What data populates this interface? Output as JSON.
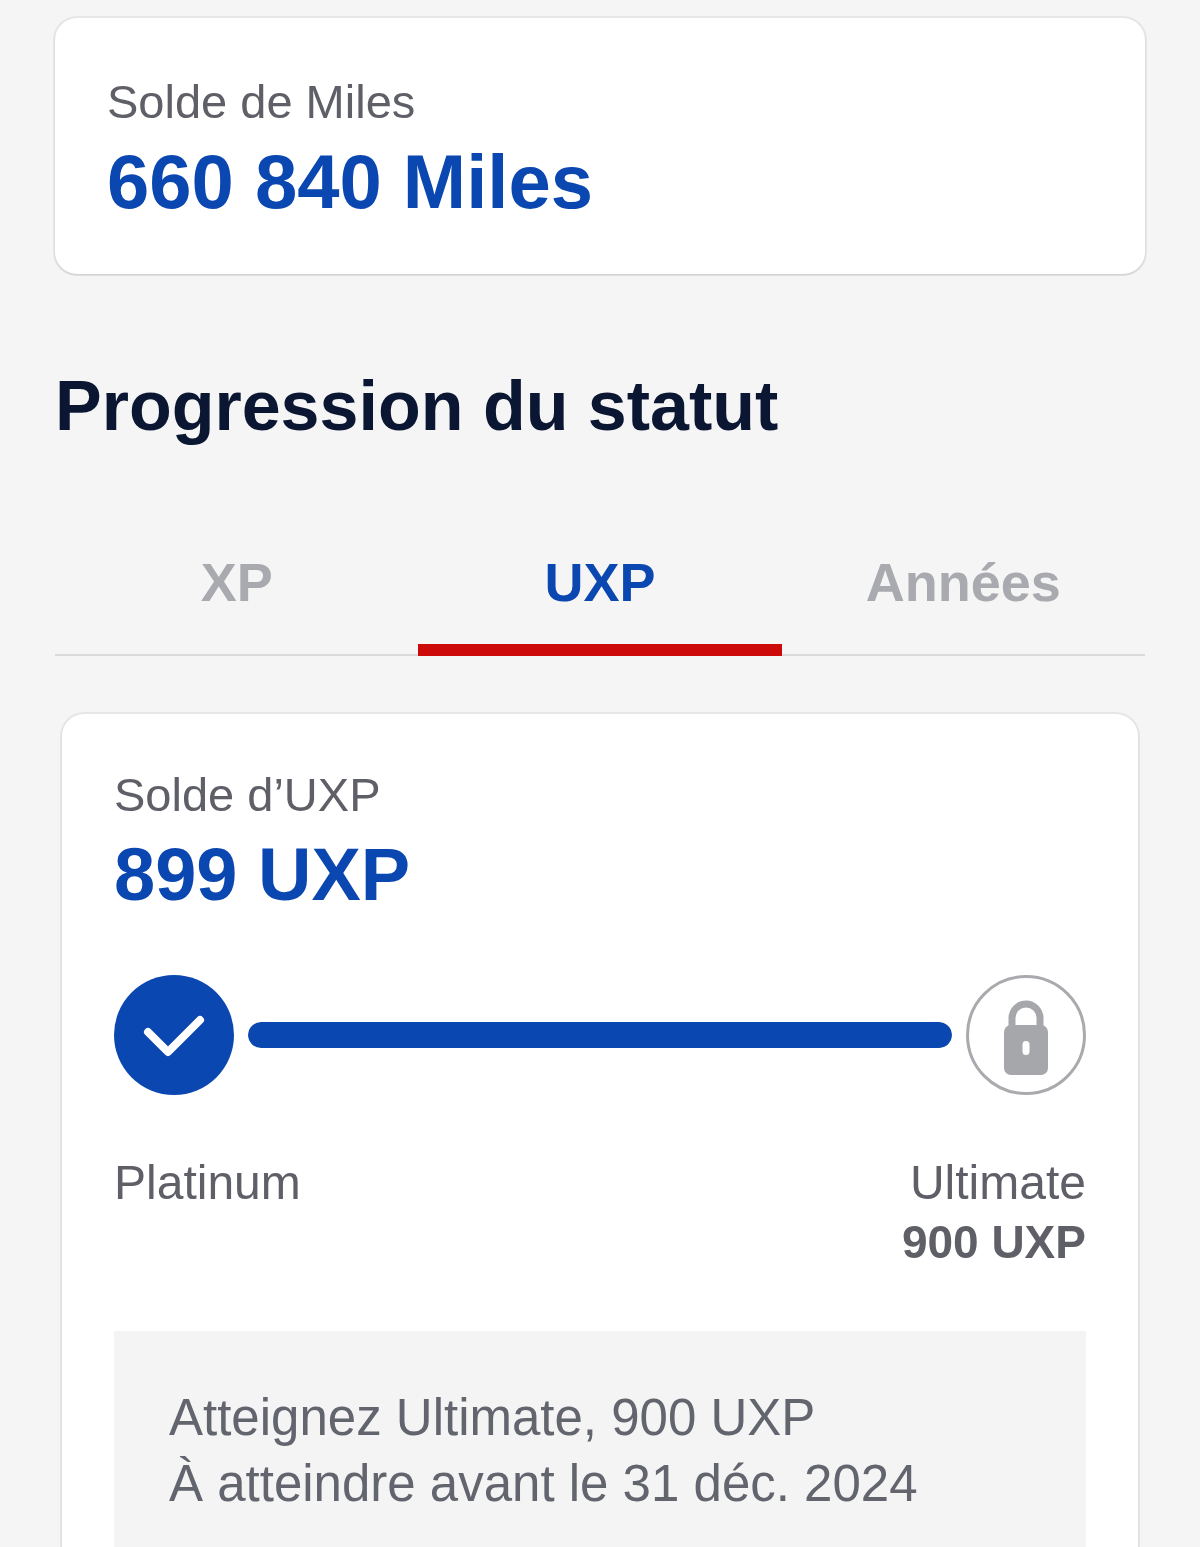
{
  "miles_card": {
    "label": "Solde de Miles",
    "value": "660 840 Miles"
  },
  "section_title": "Progression du statut",
  "tabs": [
    {
      "label": "XP",
      "selected": false
    },
    {
      "label": "UXP",
      "selected": true
    },
    {
      "label": "Années",
      "selected": false
    }
  ],
  "balance_card": {
    "label": "Solde d’UXP",
    "value": "899 UXP",
    "progress": {
      "level": 1
    },
    "milestones": [
      {
        "label": "Platinum",
        "reached": true
      },
      {
        "label": "Ultimate",
        "value": "900 UXP",
        "reached": false
      }
    ],
    "info": [
      "Atteignez Ultimate, 900 UXP",
      "À atteindre avant le 31 déc. 2024"
    ]
  }
}
